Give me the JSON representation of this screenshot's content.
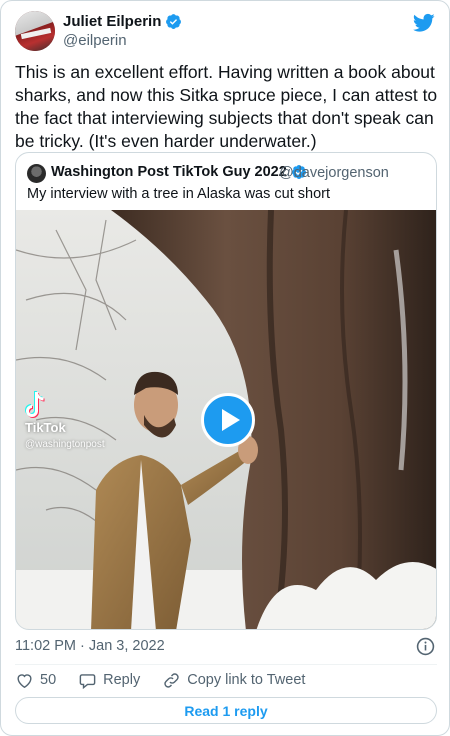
{
  "author": {
    "name": "Juliet Eilperin",
    "handle": "@eilperin",
    "verified": true,
    "avatar_icon": "profile-photo"
  },
  "tweet_text": "This is an excellent effort. Having written a book about sharks, and now this Sitka spruce piece, I can attest to the fact that interviewing subjects that don't speak can be tricky. (It's even harder underwater.)",
  "quoted_tweet": {
    "name": "Washington Post TikTok Guy 2022",
    "handle": "@davejorgenson",
    "verified": true,
    "text": "My interview with a tree in Alaska was cut short",
    "video": {
      "watermark_brand": "TikTok",
      "watermark_user": "@washingtonpost",
      "play_icon": "play-icon"
    }
  },
  "timestamp": "11:02 PM · Jan 3, 2022",
  "actions": {
    "like_count": "50",
    "reply_label": "Reply",
    "copy_link_label": "Copy link to Tweet"
  },
  "read_reply_label": "Read 1 reply",
  "colors": {
    "accent": "#1d9bf0",
    "text": "#0f1419",
    "secondary": "#536471",
    "border": "#cfd9de"
  }
}
